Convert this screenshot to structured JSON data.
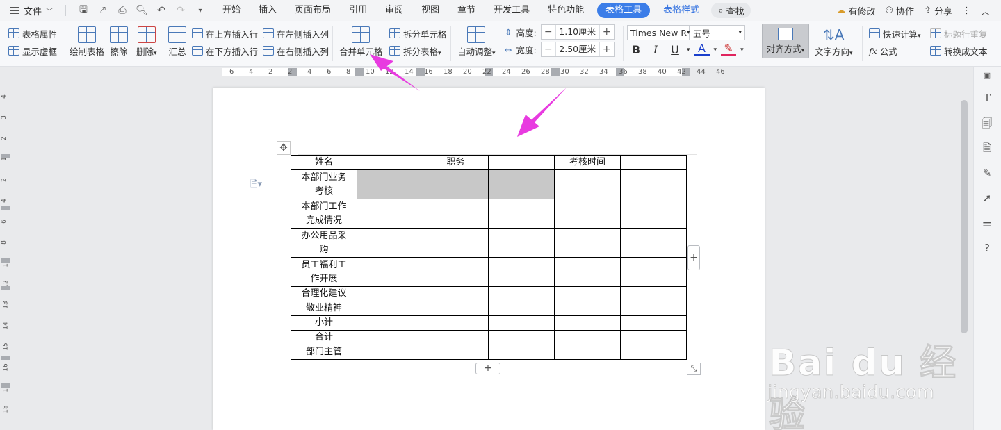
{
  "menubar": {
    "file_label": "文件",
    "tabs": [
      "开始",
      "插入",
      "页面布局",
      "引用",
      "审阅",
      "视图",
      "章节",
      "开发工具",
      "特色功能"
    ],
    "active_tab": "表格工具",
    "extra_tab": "表格样式",
    "search_label": "查找",
    "has_changes": "有修改",
    "collab": "协作",
    "share": "分享"
  },
  "ribbon": {
    "table_props": "表格属性",
    "show_gridlines": "显示虚框",
    "draw_table": "绘制表格",
    "erase": "擦除",
    "delete": "删除",
    "summary": "汇总",
    "insert_above": "在上方插入行",
    "insert_below": "在下方插入行",
    "insert_left": "在左侧插入列",
    "insert_right": "在右侧插入列",
    "merge_cells": "合并单元格",
    "split_cells": "拆分单元格",
    "split_table": "拆分表格",
    "auto_fit": "自动调整",
    "height_label": "高度:",
    "height_value": "1.10厘米",
    "width_label": "宽度:",
    "width_value": "2.50厘米",
    "font_name": "Times New R",
    "font_size": "五号",
    "align": "对齐方式",
    "text_direction": "文字方向",
    "quick_calc": "快速计算",
    "formula": "公式",
    "repeat_header": "标题行重复",
    "to_text": "转换成文本"
  },
  "ruler": {
    "h_numbers": [
      "6",
      "4",
      "2",
      "2",
      "4",
      "6",
      "8",
      "10",
      "12",
      "14",
      "16",
      "18",
      "20",
      "22",
      "24",
      "26",
      "28",
      "30",
      "32",
      "34",
      "36",
      "38",
      "40",
      "42",
      "44",
      "46"
    ],
    "v_numbers": [
      "4",
      "3",
      "2",
      "1",
      "2",
      "4",
      "6",
      "8",
      "10",
      "12",
      "13",
      "14",
      "15",
      "16",
      "17",
      "18"
    ]
  },
  "table": {
    "header": [
      "姓名",
      "",
      "职务",
      "",
      "考核时间",
      ""
    ],
    "rows": [
      [
        "本部门业务考核",
        "",
        "",
        "",
        "",
        ""
      ],
      [
        "本部门工作完成情况",
        "",
        "",
        "",
        "",
        ""
      ],
      [
        "办公用品采购",
        "",
        "",
        "",
        "",
        ""
      ],
      [
        "员工福利工作开展",
        "",
        "",
        "",
        "",
        ""
      ],
      [
        "合理化建议",
        "",
        "",
        "",
        "",
        ""
      ],
      [
        "敬业精神",
        "",
        "",
        "",
        "",
        ""
      ],
      [
        "小计",
        "",
        "",
        "",
        "",
        ""
      ],
      [
        "合计",
        "",
        "",
        "",
        "",
        ""
      ],
      [
        "部门主管",
        "",
        "",
        "",
        "",
        ""
      ]
    ]
  },
  "table_controls": {
    "add_col": "+",
    "add_row": "+"
  },
  "watermark": {
    "brand": "Bai du 经验",
    "url": "jingyan.baidu.com"
  },
  "colors": {
    "accent": "#3b7de8",
    "arrow": "#e83be0",
    "selection": "#c8c8c8"
  }
}
